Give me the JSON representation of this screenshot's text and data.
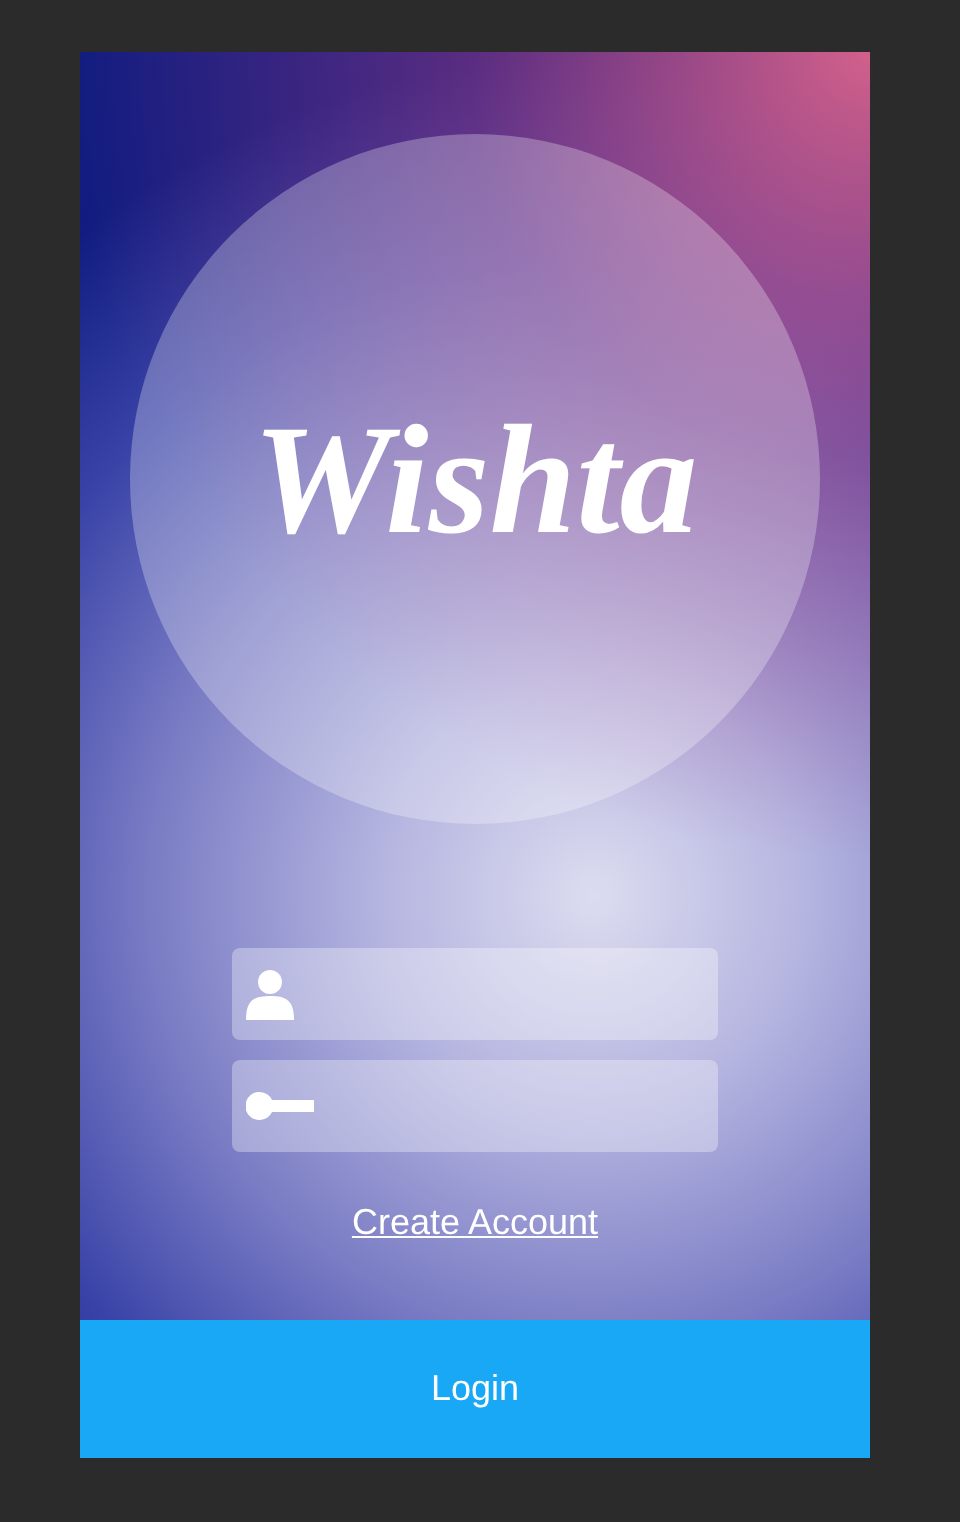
{
  "logo": {
    "text": "Wishta"
  },
  "fields": [
    {
      "kind": "username"
    },
    {
      "kind": "password"
    }
  ],
  "create_account_link": "Create Account",
  "login_button": "Login"
}
